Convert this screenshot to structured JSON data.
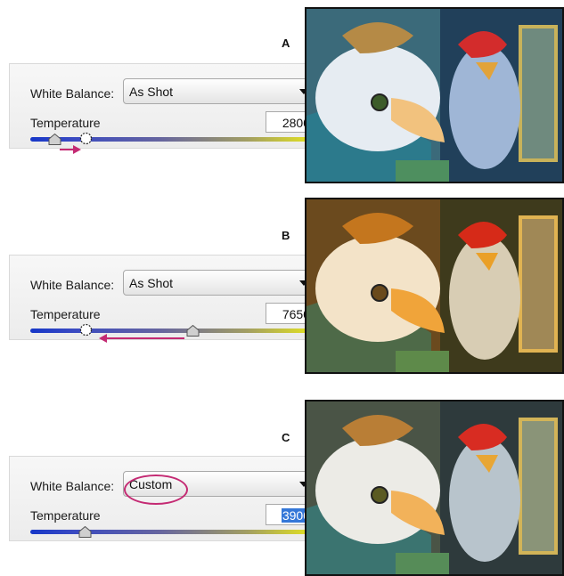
{
  "sections": [
    {
      "letter": "A",
      "white_balance_label": "White Balance:",
      "white_balance_value": "As Shot",
      "temperature_label": "Temperature",
      "temperature_value": "2800",
      "temperature_selected": false,
      "tint": "cool",
      "drag_hint": "right"
    },
    {
      "letter": "B",
      "white_balance_label": "White Balance:",
      "white_balance_value": "As Shot",
      "temperature_label": "Temperature",
      "temperature_value": "7650",
      "temperature_selected": false,
      "tint": "warm",
      "drag_hint": "left"
    },
    {
      "letter": "C",
      "white_balance_label": "White Balance:",
      "white_balance_value": "Custom",
      "temperature_label": "Temperature",
      "temperature_value": "3900",
      "temperature_selected": true,
      "tint": "neutral",
      "drag_hint": "none"
    }
  ],
  "colors": {
    "slider_cool": "#1637c8",
    "slider_warm": "#e9e91a",
    "highlight": "#c42a73",
    "selection": "#3477d8"
  },
  "icons": [
    "dropdown-arrow-icon",
    "slider-thumb-icon",
    "ghost-thumb-icon",
    "drag-arrow-icon"
  ]
}
